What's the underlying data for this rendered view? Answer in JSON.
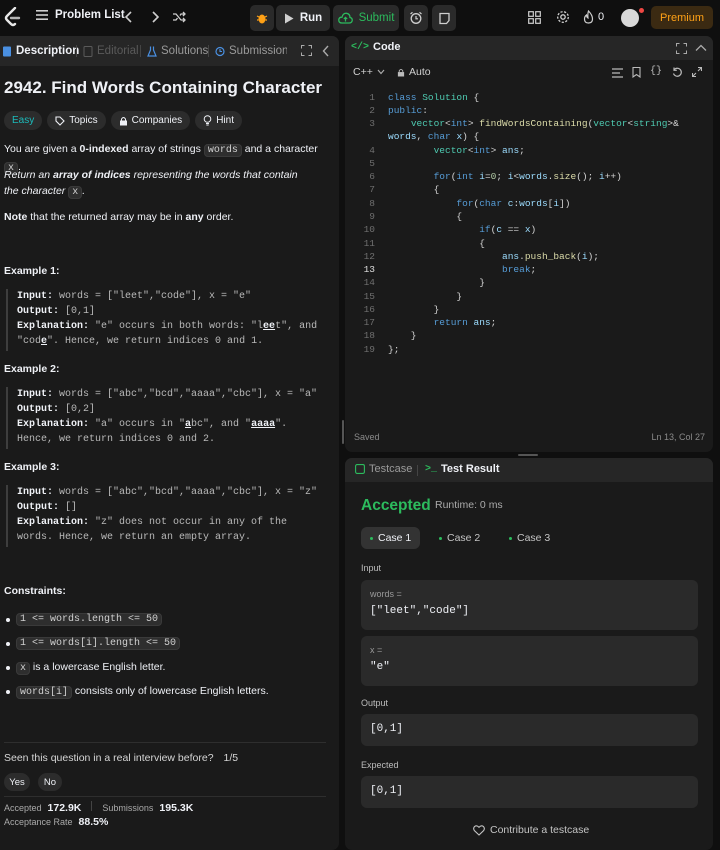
{
  "topbar": {
    "problem_list": "Problem List",
    "run": "Run",
    "submit": "Submit",
    "streak": "0",
    "premium": "Premium"
  },
  "left_tabs": {
    "description": "Description",
    "editorial": "Editorial",
    "solutions": "Solutions",
    "submissions": "Submissions"
  },
  "problem": {
    "title": "2942. Find Words Containing Character",
    "difficulty": "Easy",
    "chips": {
      "topics": "Topics",
      "companies": "Companies",
      "hint": "Hint"
    },
    "p1": {
      "a": "You are given a ",
      "b": "0-indexed",
      "c": " array of strings ",
      "d": "words",
      "e": " and a character ",
      "f": "x",
      "g": "."
    },
    "p2": {
      "a": "Return an ",
      "b": "array of indices",
      "c": " representing the words that contain the character ",
      "d": "x",
      "e": "."
    },
    "p3": {
      "a": "Note",
      "b": " that the returned array may be in ",
      "c": "any",
      "d": " order."
    }
  },
  "examples": [
    {
      "heading": "Example 1:",
      "input_label": "Input:",
      "input": " words = [\"leet\",\"code\"], x = \"e\"",
      "output_label": "Output:",
      "output": " [0,1]",
      "exp_label": "Explanation:",
      "exp_a": " \"e\" occurs in both words: \"l",
      "exp_b": "ee",
      "exp_c": "t\", and \"cod",
      "exp_d": "e",
      "exp_e": "\". Hence, we return indices 0 and 1."
    },
    {
      "heading": "Example 2:",
      "input_label": "Input:",
      "input": " words = [\"abc\",\"bcd\",\"aaaa\",\"cbc\"], x = \"a\"",
      "output_label": "Output:",
      "output": " [0,2]",
      "exp_label": "Explanation:",
      "exp_a": " \"a\" occurs in \"",
      "exp_b": "a",
      "exp_c": "bc\", and \"",
      "exp_d": "aaaa",
      "exp_e": "\". Hence, we return indices 0 and 2."
    },
    {
      "heading": "Example 3:",
      "input_label": "Input:",
      "input": " words = [\"abc\",\"bcd\",\"aaaa\",\"cbc\"], x = \"z\"",
      "output_label": "Output:",
      "output": " []",
      "exp_label": "Explanation:",
      "exp_text": " \"z\" does not occur in any of the words. Hence, we return an empty array."
    }
  ],
  "constraints": {
    "heading": "Constraints:",
    "c1": "1 <= words.length <= 50",
    "c2": "1 <= words[i].length <= 50",
    "c3_code": "x",
    "c3_text": " is a lowercase English letter.",
    "c4_code": "words[i]",
    "c4_text": " consists only of lowercase English letters."
  },
  "footer": {
    "interview_q": "Seen this question in a real interview before?",
    "pager": "1/5",
    "yes": "Yes",
    "no": "No",
    "accepted_label": "Accepted",
    "accepted_val": "172.9K",
    "submissions_label": "Submissions",
    "submissions_val": "195.3K",
    "rate_label": "Acceptance Rate",
    "rate_val": "88.5%"
  },
  "code_panel": {
    "title": "Code",
    "language": "C++",
    "auto": "Auto",
    "status": "Saved",
    "cursor": "Ln 13, Col 27",
    "lines": [
      {
        "n": "1"
      },
      {
        "n": "2"
      },
      {
        "n": "3"
      },
      {
        "n": ""
      },
      {
        "n": "4"
      },
      {
        "n": "5"
      },
      {
        "n": "6"
      },
      {
        "n": "7"
      },
      {
        "n": "8"
      },
      {
        "n": "9"
      },
      {
        "n": "10"
      },
      {
        "n": "11"
      },
      {
        "n": "12"
      },
      {
        "n": "13"
      },
      {
        "n": "14"
      },
      {
        "n": "15"
      },
      {
        "n": "16"
      },
      {
        "n": "17"
      },
      {
        "n": "18"
      },
      {
        "n": "19"
      }
    ]
  },
  "result_panel": {
    "tab_testcase": "Testcase",
    "tab_result": "Test Result",
    "verdict": "Accepted",
    "runtime": "Runtime: 0 ms",
    "cases": [
      "Case 1",
      "Case 2",
      "Case 3"
    ],
    "input_label": "Input",
    "words_label": "words =",
    "words_val": "[\"leet\",\"code\"]",
    "x_label": "x =",
    "x_val": "\"e\"",
    "output_label": "Output",
    "output_val": "[0,1]",
    "expected_label": "Expected",
    "expected_val": "[0,1]",
    "contribute": "Contribute a testcase"
  },
  "colors": {
    "accent_orange": "#ffa116",
    "accepted_green": "#2cbb5d",
    "easy_teal": "#1cbaba",
    "tab_blue": "#4a90e2",
    "panel_bg": "#1a1a1a",
    "page_bg": "#0f0f0f"
  }
}
